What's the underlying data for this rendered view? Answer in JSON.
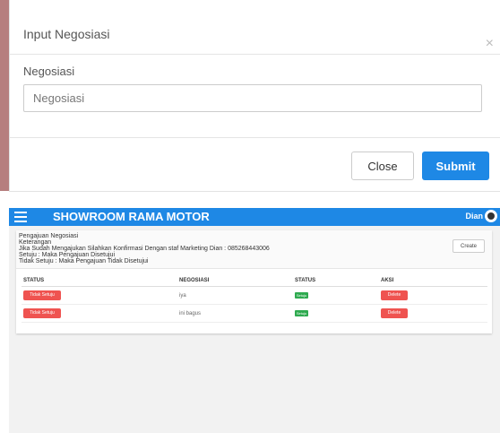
{
  "modal": {
    "title": "Input Negosiasi",
    "close_icon": "×",
    "field_label": "Negosiasi",
    "field_placeholder": "Negosiasi",
    "field_value": "",
    "close_button": "Close",
    "submit_button": "Submit"
  },
  "navbar": {
    "brand": "SHOWROOM RAMA MOTOR",
    "user": "Dian",
    "color": "#1e88e5"
  },
  "info": {
    "line1": "Pengajuan Negosiasi",
    "line2": "Keterangan",
    "line3": "Jika Sudah Mengajukan Silahkan Konfirmasi Dengan staf Marketing Dian : 085268443006",
    "line4": "Setuju : Maka Pengajuan Disetujui",
    "line5": "Tidak Setuju : Maka Pengajuan Tidak Disetujui"
  },
  "create_button": "Create",
  "table": {
    "headers": [
      "STATUS",
      "NEGOSIASI",
      "STATUS",
      "AKSI"
    ],
    "rows": [
      {
        "status_button": "Tidak Setuju",
        "negosiasi": "iya",
        "badge": "Setuju",
        "action": "Delete"
      },
      {
        "status_button": "Tidak Setuju",
        "negosiasi": "ini bagus",
        "badge": "Setuju",
        "action": "Delete"
      }
    ]
  },
  "colors": {
    "primary": "#1e88e5",
    "danger": "#ef5350",
    "success": "#2eaa4f"
  }
}
